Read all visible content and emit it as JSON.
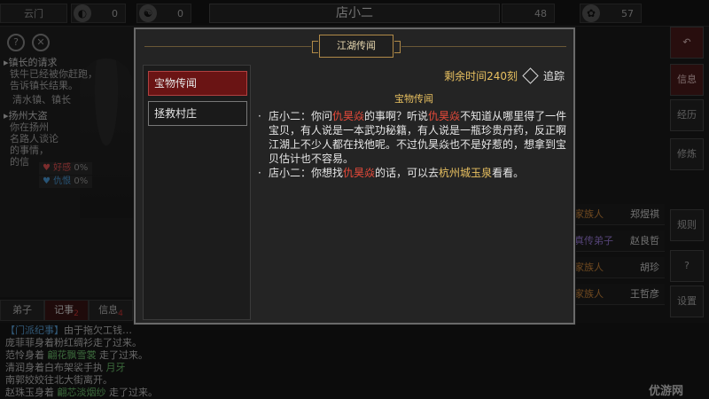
{
  "topbar": {
    "sect": "云门",
    "res1": "0",
    "res2": "0",
    "title": "店小二",
    "res3": "48",
    "res4": "57"
  },
  "quests": [
    {
      "title": "镇长的请求",
      "lines": [
        "铁牛已经被你赶跑，",
        "告诉镇长结果。"
      ]
    },
    {
      "title": "扬州大盗",
      "lines": [
        "你在扬州",
        "名路人谈论",
        "的事情，",
        "的信"
      ],
      "extra": "清水镇、镇长"
    }
  ],
  "relations": {
    "fav": "好感",
    "fav_val": "0%",
    "hate": "仇恨",
    "hate_val": "0%"
  },
  "bottom_tabs": [
    {
      "label": "弟子",
      "badge": ""
    },
    {
      "label": "记事",
      "badge": "2"
    },
    {
      "label": "信息",
      "badge": "4"
    }
  ],
  "log": [
    {
      "pre": "【门派纪事】",
      "text": "由于拖欠工钱…"
    },
    {
      "pre": "",
      "text": "庞菲菲身着粉红绸衫走了过来。"
    },
    {
      "pre": "",
      "text": "范怜身着 ",
      "em": "翩花飘雪裳",
      "post": " 走了过来。"
    },
    {
      "pre": "",
      "text": "清润身着白布架裟手执 ",
      "em": "月牙",
      "post": ""
    },
    {
      "pre": "",
      "text": "南郭姣姣往北大街离开。"
    },
    {
      "pre": "",
      "text": "赵珠玉身着 ",
      "em": "翩芯淡烟纱",
      "post": " 走了过来。"
    }
  ],
  "side_buttons": [
    "信息",
    "经历",
    "修炼",
    "规则",
    "?",
    "设置"
  ],
  "npcs": [
    {
      "role": "家族人",
      "name": "郑煜祺",
      "purple": false
    },
    {
      "role": "真传弟子",
      "name": "赵良哲",
      "purple": true
    },
    {
      "role": "家族人",
      "name": "胡珍",
      "purple": false
    },
    {
      "role": "家族人",
      "name": "王哲彦",
      "purple": false
    }
  ],
  "modal": {
    "title": "江湖传闻",
    "list": [
      "宝物传闻",
      "拯救村庄"
    ],
    "timer": "剩余时间240刻",
    "track": "追踪",
    "section": "宝物传闻",
    "entry1": {
      "a": "店小二：你问",
      "b": "仇昊焱",
      "c": "的事啊？听说",
      "d": "仇昊焱",
      "e": "不知道从哪里得了一件宝贝，有人说是一本武功秘籍，有人说是一瓶珍贵丹药，反正啊江湖上不少人都在找他呢。不过仇昊焱也不是好惹的，想拿到宝贝估计也不容易。"
    },
    "entry2": {
      "a": "店小二：你想找",
      "b": "仇昊焱",
      "c": "的话，可以去",
      "d": "杭州城玉泉",
      "e": "看看。"
    }
  },
  "watermark": "优游网"
}
